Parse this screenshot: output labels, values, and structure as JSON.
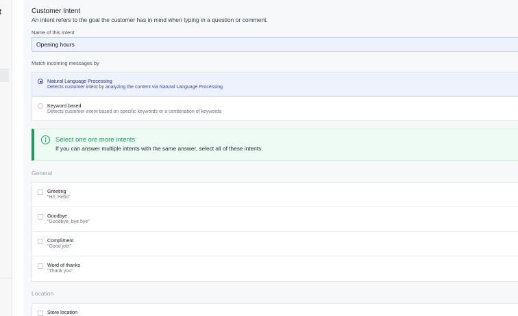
{
  "sidebar": {
    "fragment": "t"
  },
  "header": {
    "title": "Customer Intent",
    "description": "An intent refers to the goal the customer has in mind when typing in a question or comment."
  },
  "name_field": {
    "label": "Name of this intent",
    "value": "Opening hours"
  },
  "match": {
    "label": "Match incoming messages by",
    "options": [
      {
        "title": "Natural Language Processing",
        "subtitle": "Detects customer intent by analyzing the content via Natural Language Processing",
        "selected": true
      },
      {
        "title": "Keyword based",
        "subtitle": "Detects customer intent based on specific keywords or a combination of keywords",
        "selected": false
      }
    ]
  },
  "info": {
    "title": "Select one ore more intents",
    "text": "If you can answer multiple intents with the same answer, select all of these intents."
  },
  "groups": [
    {
      "label": "General",
      "items": [
        {
          "title": "Greeting",
          "example": "\"Hi!, Hello\""
        },
        {
          "title": "Goodbye",
          "example": "\"Goodbye, bye bye\""
        },
        {
          "title": "Compliment",
          "example": "\"Good job!\""
        },
        {
          "title": "Word of thanks",
          "example": "\"Thank you\""
        }
      ]
    },
    {
      "label": "Location",
      "items": [
        {
          "title": "Store location",
          "example": ""
        }
      ]
    }
  ],
  "colors": {
    "accent": "#3b4ca8",
    "success": "#1f9a5a",
    "selected_bg": "#eef2fc"
  }
}
